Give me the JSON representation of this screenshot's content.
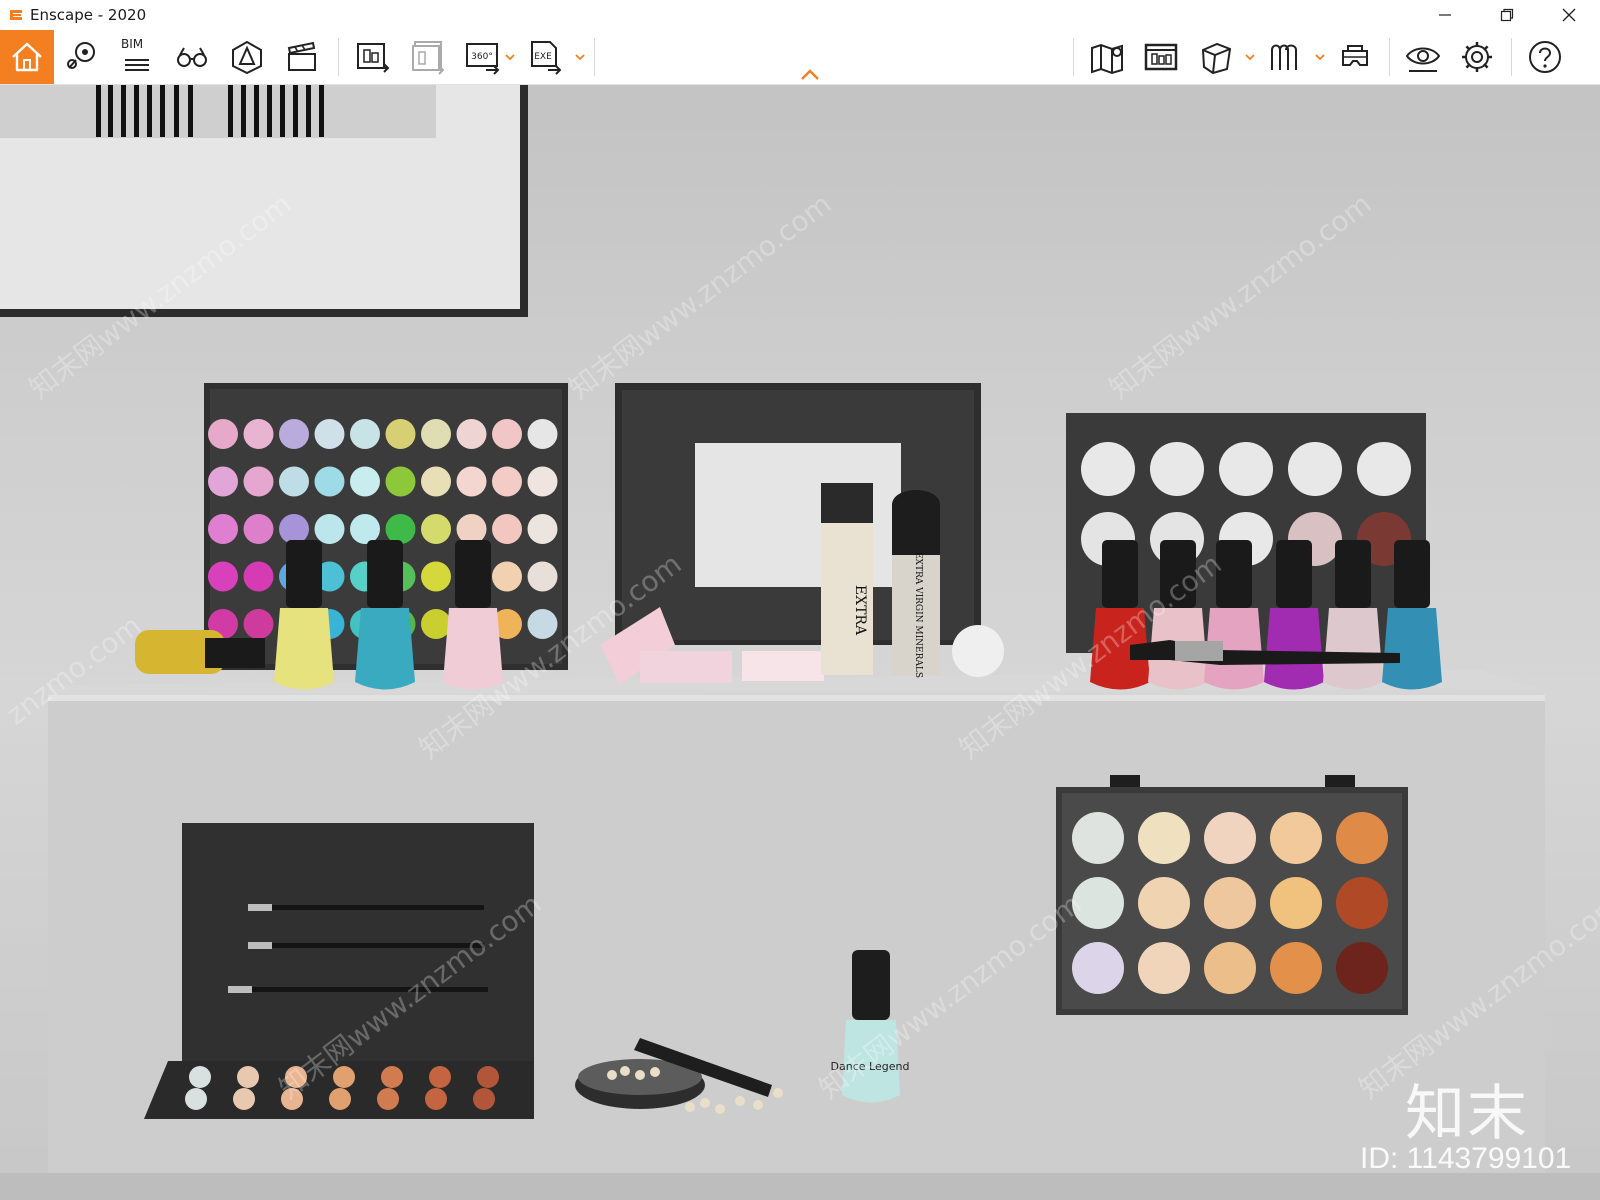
{
  "window": {
    "title": "Enscape - 2020",
    "controls": [
      "minimize-icon",
      "restore-icon",
      "close-icon"
    ]
  },
  "toolbar": {
    "accent_color": "#f47f20",
    "bim_label": "BIM",
    "left_tools": [
      "home-icon",
      "view-management-icon",
      "bim-icon",
      "walk-mode-icon",
      "asset-library-icon",
      "video-editor-icon",
      "render-screenshot-icon",
      "batch-render-icon",
      "panorama-360-icon",
      "export-exe-icon"
    ],
    "panorama_label": "360°",
    "exe_label": "EXE",
    "right_tools": [
      "minimap-icon",
      "web-standalone-icon",
      "export-model-icon",
      "collaborative-annotation-icon",
      "vr-headset-icon",
      "visual-settings-icon",
      "settings-icon",
      "help-icon"
    ]
  },
  "viewport": {
    "product_label": "Dance Legend",
    "bottle_text_1": "EXTRA",
    "bottle_text_2": "EXTRA VIRGIN MINERALS",
    "watermark_url": "知末网www.znzmo.com",
    "watermark_short": "znzmo.com",
    "brand_watermark": "知末",
    "id_text": "ID: 1143799101"
  }
}
